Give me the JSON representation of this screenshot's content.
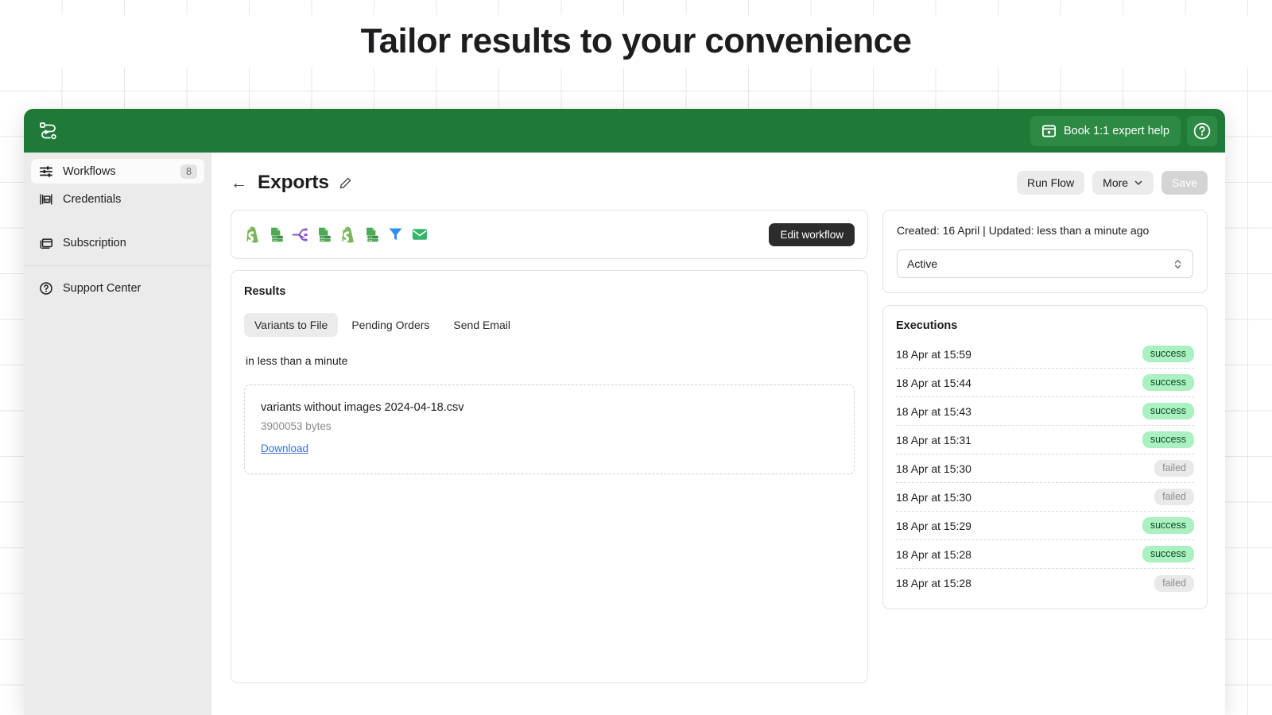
{
  "hero": {
    "title": "Tailor results to your convenience"
  },
  "topbar": {
    "logo_icon": "workflow-play-logo",
    "book_help_label": "Book 1:1 expert help",
    "calendar_icon": "calendar-icon",
    "help_icon": "question-mark-circle-icon",
    "bg_color": "#1f7a38"
  },
  "sidebar": {
    "items": [
      {
        "label": "Workflows",
        "icon": "sliders-icon",
        "badge": "8",
        "active": true
      },
      {
        "label": "Credentials",
        "icon": "credentials-icon",
        "badge": "",
        "active": false
      },
      {
        "label": "Subscription",
        "icon": "card-stack-icon",
        "badge": "",
        "active": false
      },
      {
        "label": "Support Center",
        "icon": "question-circle-icon",
        "badge": "",
        "active": false
      }
    ]
  },
  "page_head": {
    "back_icon": "arrow-left-icon",
    "title": "Exports",
    "edit_icon": "pencil-icon",
    "run_flow_label": "Run Flow",
    "more_label": "More",
    "more_icon": "chevron-down-icon",
    "save_label": "Save"
  },
  "nodes": {
    "icons": [
      "shopify-icon",
      "file-server-icon",
      "split-branch-icon",
      "file-server-icon",
      "shopify-icon",
      "file-server-icon",
      "filter-funnel-icon",
      "email-envelope-icon"
    ],
    "edit_workflow_label": "Edit workflow"
  },
  "results": {
    "title": "Results",
    "tabs": [
      {
        "label": "Variants to File",
        "active": true
      },
      {
        "label": "Pending Orders",
        "active": false
      },
      {
        "label": "Send Email",
        "active": false
      }
    ],
    "duration": "in less than a minute",
    "file": {
      "name": "variants without images 2024-04-18.csv",
      "size": "3900053 bytes",
      "download_label": "Download"
    }
  },
  "meta": {
    "timestamps": "Created: 16 April | Updated: less than a minute ago",
    "status_value": "Active",
    "status_icon": "up-down-chevron-icon"
  },
  "executions": {
    "title": "Executions",
    "rows": [
      {
        "time": "18 Apr at 15:59",
        "status": "success"
      },
      {
        "time": "18 Apr at 15:44",
        "status": "success"
      },
      {
        "time": "18 Apr at 15:43",
        "status": "success"
      },
      {
        "time": "18 Apr at 15:31",
        "status": "success"
      },
      {
        "time": "18 Apr at 15:30",
        "status": "failed"
      },
      {
        "time": "18 Apr at 15:30",
        "status": "failed"
      },
      {
        "time": "18 Apr at 15:29",
        "status": "success"
      },
      {
        "time": "18 Apr at 15:28",
        "status": "success"
      },
      {
        "time": "18 Apr at 15:28",
        "status": "failed"
      }
    ]
  },
  "colors": {
    "brand_green": "#1f7a38",
    "success_badge": "#aaf0c0",
    "failed_badge": "#e9e9e9",
    "link_blue": "#3a6fd8",
    "dark_button": "#2c2c2c"
  }
}
